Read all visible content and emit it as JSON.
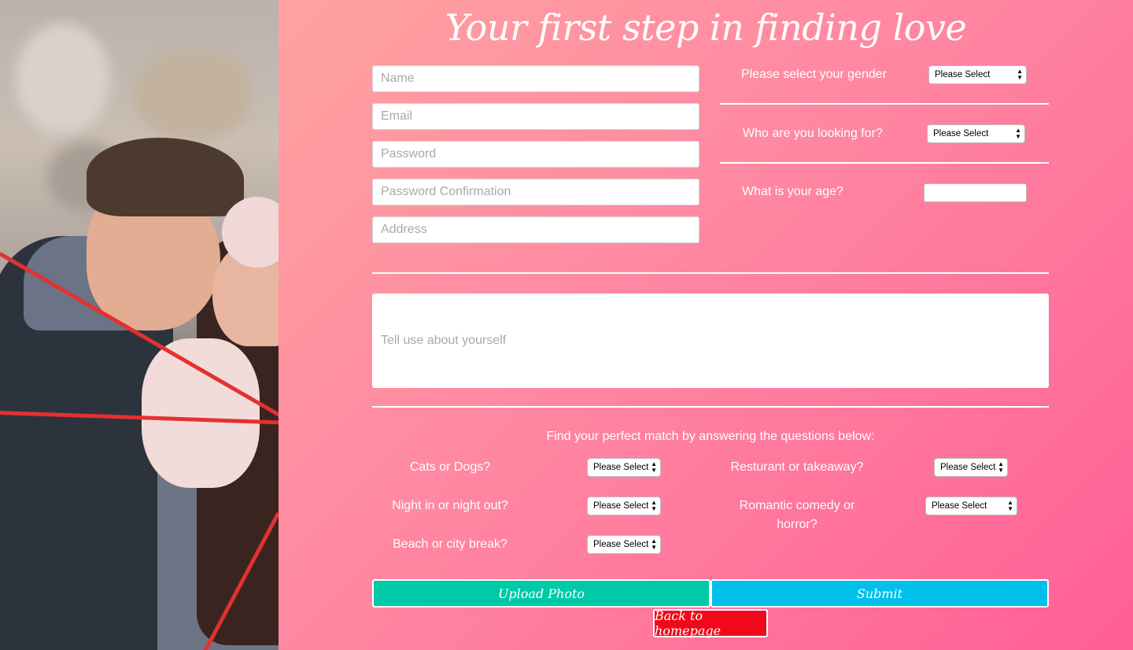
{
  "title": "Your first step in finding love",
  "form": {
    "name_placeholder": "Name",
    "email_placeholder": "Email",
    "password_placeholder": "Password",
    "password_confirmation_placeholder": "Password Confirmation",
    "address_placeholder": "Address",
    "bio_placeholder": "Tell use about yourself"
  },
  "profile_questions": {
    "gender_label": "Please select your gender",
    "gender_value": "Please Select",
    "looking_for_label": "Who are you looking for?",
    "looking_for_value": "Please Select",
    "age_label": "What is your age?"
  },
  "match": {
    "intro": "Find your perfect match by answering the questions below:",
    "questions": [
      {
        "label": "Cats or Dogs?",
        "value": "Please Select"
      },
      {
        "label": "Night in or night out?",
        "value": "Please Select"
      },
      {
        "label": "Beach or city break?",
        "value": "Please Select"
      },
      {
        "label": "Resturant or takeaway?",
        "value": "Please Select"
      },
      {
        "label": "Romantic comedy or horror?",
        "value": "Please Select"
      }
    ]
  },
  "buttons": {
    "upload_photo": "Upload Photo",
    "submit": "Submit",
    "back_home": "Back to homepage"
  },
  "colors": {
    "upload": "#00c9a7",
    "submit": "#00bfea",
    "back": "#f0091a",
    "background_start": "#ffa3a0",
    "background_end": "#ff5f96"
  }
}
